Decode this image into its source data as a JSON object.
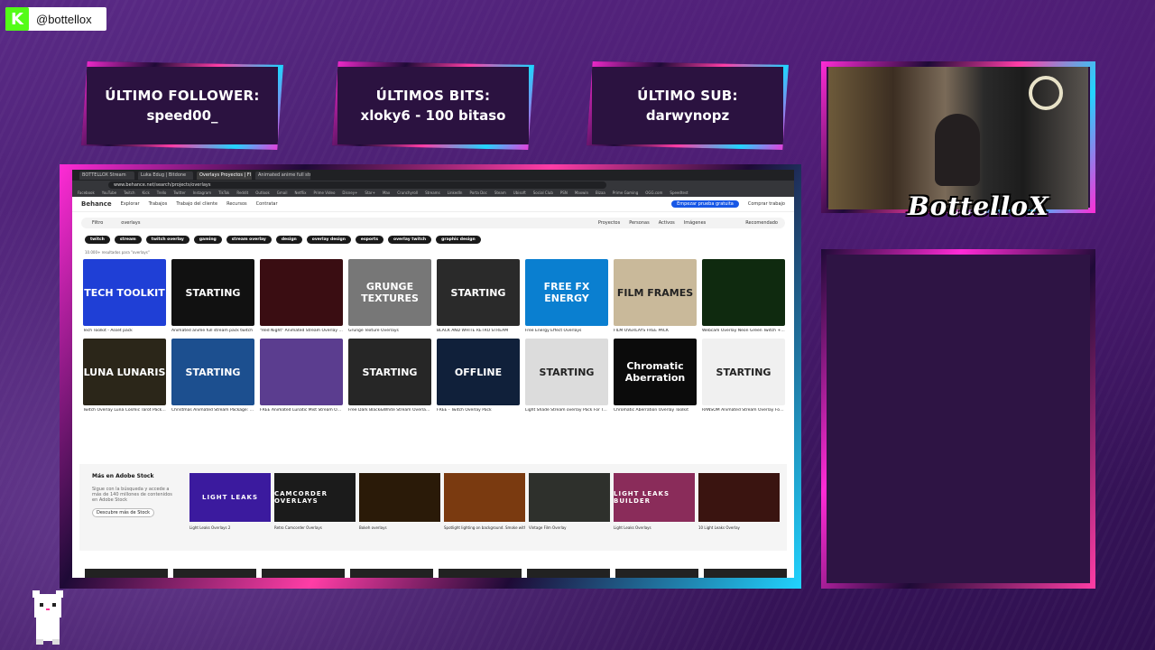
{
  "kick": {
    "handle": "@bottellox",
    "icon": "kick-logo-icon"
  },
  "overlay": {
    "follower": {
      "title": "ÚLTIMO FOLLOWER:",
      "value": "speed00_"
    },
    "bits": {
      "title": "ÚLTIMOS BITS:",
      "value": "xloky6 - 100 bitaso"
    },
    "sub": {
      "title": "ÚLTIMO SUB:",
      "value": "darwynopz"
    },
    "brand": "BottelloX"
  },
  "browser": {
    "tabs": [
      "BOTTELLOX Stream",
      "Luka Edug | Bitdone",
      "Overlays Proyectos | Fl",
      "Animated anime full stre"
    ],
    "active_tab": 2,
    "url": "www.behance.net/search/projects/overlays",
    "bookmarks": [
      "Facebook",
      "YouTube",
      "Twitch",
      "Kick",
      "Trello",
      "Twitter",
      "Instagram",
      "TikTok",
      "Reddit",
      "Outlook",
      "Gmail",
      "Netflix",
      "Prime Video",
      "Disney+",
      "Star+",
      "Max",
      "Crunchyroll",
      "Streams",
      "LinkedIn",
      "Porta Doc",
      "Steam",
      "Ubisoft",
      "Social Club",
      "PSN",
      "Maxwin",
      "Bizaa",
      "Prime Gaming",
      "OGG.com",
      "Speedtest"
    ]
  },
  "behance": {
    "logo": "Behance",
    "nav": [
      "Explorar",
      "Trabajos",
      "Trabajo del cliente",
      "Recursos",
      "Contratar"
    ],
    "cta": "Empezar prueba gratuita",
    "buy": "Comprar trabajo",
    "search_value": "overlays",
    "filter": "Filtro",
    "search_tabs": [
      "Proyectos",
      "Personas",
      "Activos",
      "Imágenes"
    ],
    "sort": "Recomendado",
    "chips": [
      "twitch",
      "stream",
      "twitch overlay",
      "gaming",
      "stream overlay",
      "design",
      "overlay design",
      "esports",
      "overlay twitch",
      "graphic design"
    ],
    "results": "10.000+ resultados para \"overlays\"",
    "cards": [
      {
        "title": "Tech Toolkit - Asset pack",
        "img": "TECH TOOLKIT",
        "color": "#1f3fd6"
      },
      {
        "title": "Animated anime full stream pack twitch",
        "img": "STARTING",
        "color": "#111"
      },
      {
        "title": "\"Red Night\" Animated Stream Overlay Pack",
        "img": "",
        "color": "#3a0d12"
      },
      {
        "title": "Grunge Texture Overlays",
        "img": "GRUNGE TEXTURES",
        "color": "#777"
      },
      {
        "title": "BLACK AND WHITE RETRO STREAM",
        "img": "STARTING",
        "color": "#2a2a2a"
      },
      {
        "title": "Free Energy Effect Overlays",
        "img": "FREE FX ENERGY",
        "color": "#0a7fd0"
      },
      {
        "title": "FILM OVERLAYS FREE PACK",
        "img": "FILM FRAMES",
        "color": "#c9b99a"
      },
      {
        "title": "Webcam Overlay Neon Green Twitch + Free Version",
        "img": "",
        "color": "#0f2a0f"
      },
      {
        "title": "Twitch Overlay Luna Cosmic Tarot Pack | Free",
        "img": "LUNA LUNARIS",
        "color": "#2b2619"
      },
      {
        "title": "Christmas Animated Stream Package: Christmas Overlays",
        "img": "STARTING",
        "color": "#1c4f8f"
      },
      {
        "title": "FREE Animated Lunatic Mist Stream Overlay Pack",
        "img": "",
        "color": "#5b3d8f"
      },
      {
        "title": "Free Dark Black&White Stream Overlay Package",
        "img": "STARTING",
        "color": "#262626"
      },
      {
        "title": "FREE - Twitch Overlay Pack",
        "img": "OFFLINE",
        "color": "#10203a"
      },
      {
        "title": "Light Shade Stream overlay Pack For Twitch",
        "img": "STARTING",
        "color": "#dcdcdc"
      },
      {
        "title": "Chromatic Aberration Overlay Toolkit",
        "img": "Chromatic Aberration",
        "color": "#0b0b0b"
      },
      {
        "title": "RANSOM Animated Stream Overlay For OBS",
        "img": "STARTING",
        "color": "#f0f0f0"
      }
    ],
    "stock": {
      "title": "Más en Adobe Stock",
      "desc": "Sigue con la búsqueda y accede a más de 140 millones de contenidos en Adobe Stock",
      "button": "Descubre más de Stock",
      "items": [
        {
          "title": "Light Leaks Overlays 2",
          "img": "LIGHT LEAKS",
          "color": "#3b1a9e"
        },
        {
          "title": "Retro Camcorder Overlays",
          "img": "CAMCORDER OVERLAYS",
          "color": "#1b1b1b"
        },
        {
          "title": "Bokeh overlays",
          "img": "",
          "color": "#2a1a08"
        },
        {
          "title": "Spotlight lighting on background. Smoke with a ...",
          "img": "",
          "color": "#7a3a10"
        },
        {
          "title": "Vintage Film Overlay",
          "img": "",
          "color": "#2e302c"
        },
        {
          "title": "Light Leaks Overlays",
          "img": "LIGHT LEAKS BUILDER",
          "color": "#8a2c5a"
        },
        {
          "title": "10 Light Leaks Overlay",
          "img": "",
          "color": "#3a1410"
        }
      ]
    }
  }
}
